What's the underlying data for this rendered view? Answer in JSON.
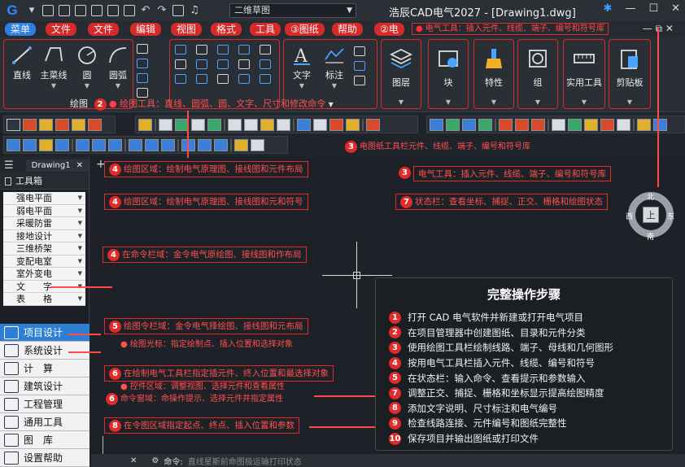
{
  "app": {
    "title": "浩辰CAD电气2027 - [Drawing1.dwg]",
    "workspace": "二维草图"
  },
  "menubar": {
    "items": [
      {
        "label": "菜单",
        "active": true
      },
      {
        "label": "文件"
      },
      {
        "label": "文件"
      },
      {
        "label": "编辑"
      },
      {
        "label": "视图"
      },
      {
        "label": "格式"
      },
      {
        "label": "工具"
      },
      {
        "label": "③图纸"
      },
      {
        "label": "帮助"
      },
      {
        "label": "②电"
      }
    ],
    "electric_tools_tag": "电气工具：插入元件、线缆、端子、编号和符号库"
  },
  "ribbon": {
    "draw_buttons": [
      "直线",
      "主菜线",
      "圆",
      "圆弧"
    ],
    "text_buttons": [
      "文字",
      "标注"
    ],
    "tiles": [
      "图层",
      "块",
      "特性",
      "组",
      "实用工具",
      "剪贴板"
    ],
    "draw_caption": "绘图",
    "draw_tag": "绘图工具：直线、圆弧、圆、文字、尺寸和修改命令"
  },
  "annotations": {
    "toolbar_row": "电图纸工具栏元件、线缆、端子、编号和符号库",
    "drawing_tab": "绘图区域：绘制电气原理图、接线图和元件布局",
    "electric_tools": "电气工具：插入元件、线缆、端子、编号和符号库",
    "draw_region": "绘图区域：绘制电气原理图、接线图和元和符号",
    "status_bar": "状态栏：查看坐标、捕捉、正交、栅格和绘图状态",
    "command_area": "在命令栏域：金令电气原绘图、接线图和作布局",
    "draw_cmd": "绘图令栏域：金令电气择绘图、接线图和元布局",
    "cursor": "绘图光标：指定绘制点、插入位置和选择对象",
    "tool_insert": "在绘制电气工具栏指定插元件、终入位置和最选择对象",
    "ctrl_zoom": "控件区域：调整视图、选择元件和查看属性",
    "cmd_note": "命令窗域：命操作提示、选择元件并指定属性",
    "cmd_points": "在令图区域指定起点、终点、插入位置和参数"
  },
  "sidebar": {
    "doc_tab": "Drawing1",
    "panel_title": "工具箱",
    "library": [
      "强电平面",
      "弱电平面",
      "采暖防雷",
      "接地设计",
      "三维桥架",
      "变配电室",
      "室外变电",
      "文　　字",
      "表　　格"
    ],
    "categories": [
      {
        "label": "项目设计",
        "active": true
      },
      {
        "label": "系统设计"
      },
      {
        "label": "计　算"
      },
      {
        "label": "建筑设计"
      },
      {
        "label": "工程管理"
      },
      {
        "label": "通用工具"
      },
      {
        "label": "图　库"
      },
      {
        "label": "设置帮助"
      }
    ]
  },
  "viewcube": {
    "center": "上",
    "north": "北",
    "south": "南",
    "east": "东",
    "west": "西"
  },
  "steps": {
    "title": "完整操作步骤",
    "items": [
      {
        "n": "1",
        "text": "打开 CAD 电气软件并新建或打开电气项目"
      },
      {
        "n": "2",
        "text": "在项目管理器中创建图纸、目录和元件分类"
      },
      {
        "n": "3",
        "text": "使用绘图工具栏绘制线路、端子、母线和几何图形"
      },
      {
        "n": "4",
        "text": "按用电气工具栏插入元件、线缆、编号和符号"
      },
      {
        "n": "5",
        "text": "在状态栏：输入命令、查看提示和参数输入"
      },
      {
        "n": "7",
        "text": "调整正交、捕捉、栅格和坐标显示提高绘图精度"
      },
      {
        "n": "8",
        "text": "添加文字说明、尺寸标注和电气编号"
      },
      {
        "n": "9",
        "text": "检查线路连接、元件编号和图纸完整性"
      },
      {
        "n": "10",
        "text": "保存项目并输出图纸或打印文件"
      }
    ]
  },
  "command": {
    "label": "命令:",
    "hint": "直线星斯前命图极运输打印状态"
  },
  "colors": {
    "accent_red": "#e12a2a",
    "accent_blue": "#2d7fe0",
    "background": "#1f232a"
  }
}
